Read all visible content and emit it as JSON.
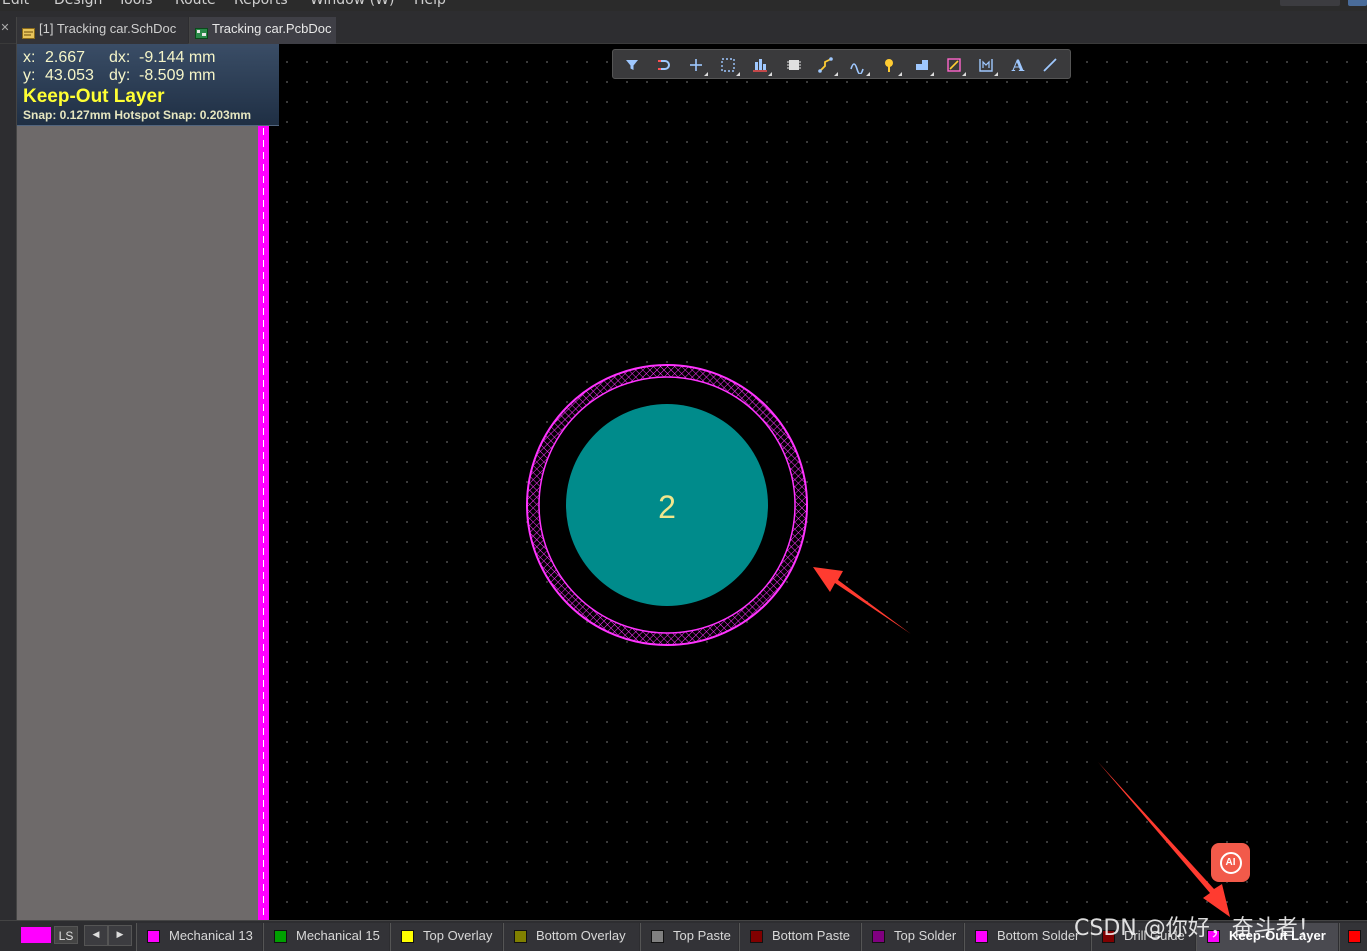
{
  "menu": {
    "items": [
      "Edit",
      "Design",
      "Tools",
      "Route",
      "Reports",
      "Window (W)",
      "Help"
    ]
  },
  "tabs": [
    {
      "label": "[1] Tracking car.SchDoc",
      "icon": "schematic-doc-icon",
      "active": false
    },
    {
      "label": "Tracking car.PcbDoc",
      "icon": "pcb-doc-icon",
      "active": true
    }
  ],
  "hud": {
    "x_label": "x:",
    "x_value": "2.667",
    "dx_label": "dx:",
    "dx_value": "-9.144 mm",
    "y_label": "y:",
    "y_value": "43.053",
    "dy_label": "dy:",
    "dy_value": "-8.509 mm",
    "layer": "Keep-Out Layer",
    "snap": "Snap: 0.127mm Hotspot Snap: 0.203mm"
  },
  "toolbar": {
    "tools": [
      "filter-icon",
      "interactive-routing-select-icon",
      "place-plus-icon",
      "select-area-icon",
      "align-icon",
      "place-component-icon",
      "route-icon",
      "diff-pair-icon",
      "place-pad-icon",
      "fill-icon",
      "polygon-icon",
      "dimension-icon",
      "place-string-icon",
      "place-line-icon"
    ]
  },
  "pad": {
    "designator": "2",
    "pad_color": "#008b8b",
    "keepout_color": "#ff33ff"
  },
  "layer_bar": {
    "current_label": "LS",
    "current_color": "#ff00ff",
    "layers": [
      {
        "name": "Mechanical 13",
        "color": "#ff00ff"
      },
      {
        "name": "Mechanical 15",
        "color": "#00a000"
      },
      {
        "name": "Top Overlay",
        "color": "#ffff00"
      },
      {
        "name": "Bottom Overlay",
        "color": "#808000"
      },
      {
        "name": "Top Paste",
        "color": "#808080"
      },
      {
        "name": "Bottom Paste",
        "color": "#800000"
      },
      {
        "name": "Top Solder",
        "color": "#800080"
      },
      {
        "name": "Bottom Solder",
        "color": "#ff00ff"
      },
      {
        "name": "Drill Guide",
        "color": "#800000"
      },
      {
        "name": "Keep-Out Layer",
        "color": "#ff00ff"
      }
    ],
    "trailing_color": "#ff0000"
  },
  "ai_badge": "AI",
  "watermark": "CSDN @你好，奋斗者！"
}
